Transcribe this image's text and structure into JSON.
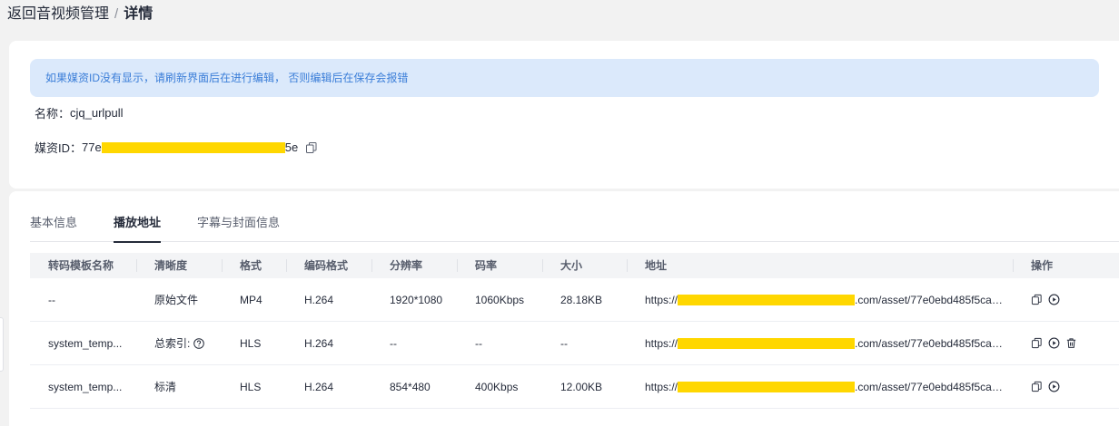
{
  "breadcrumb": {
    "back": "返回音视频管理",
    "separator": "/",
    "current": "详情"
  },
  "notice": "如果媒资ID没有显示，请刷新界面后在进行编辑， 否则编辑后在保存会报错",
  "media": {
    "name_label": "名称：",
    "name_value": "cjq_urlpull",
    "id_label": "媒资ID：",
    "id_prefix": "77e",
    "id_suffix": "5e"
  },
  "tabs": [
    {
      "label": "基本信息",
      "active": false
    },
    {
      "label": "播放地址",
      "active": true
    },
    {
      "label": "字幕与封面信息",
      "active": false
    }
  ],
  "table": {
    "headers": [
      "转码模板名称",
      "清晰度",
      "格式",
      "编码格式",
      "分辨率",
      "码率",
      "大小",
      "地址",
      "操作"
    ],
    "rows": [
      {
        "template": "--",
        "definition": "原始文件",
        "format": "MP4",
        "codec": "H.264",
        "resolution": "1920*1080",
        "bitrate": "1060Kbps",
        "size": "28.18KB",
        "url_prefix": "https://",
        "url_suffix": ".com/asset/77e0ebd485f5caf...",
        "ops": [
          "copy-icon",
          "play-icon"
        ]
      },
      {
        "template": "system_temp...",
        "definition": "总索引:",
        "format": "HLS",
        "codec": "H.264",
        "resolution": "--",
        "bitrate": "--",
        "size": "--",
        "url_prefix": "https://",
        "url_suffix": ".com/asset/77e0ebd485f5caf...",
        "ops": [
          "copy-icon",
          "play-icon",
          "delete-icon"
        ]
      },
      {
        "template": "system_temp...",
        "definition": "标清",
        "format": "HLS",
        "codec": "H.264",
        "resolution": "854*480",
        "bitrate": "400Kbps",
        "size": "12.00KB",
        "url_prefix": "https://",
        "url_suffix": ".com/asset/77e0ebd485f5caf...",
        "ops": [
          "copy-icon",
          "play-icon"
        ]
      }
    ]
  },
  "colors": {
    "notice_bg": "#dbe9fb",
    "notice_text": "#3b7ed8",
    "redaction": "#ffd700",
    "text": "#252b3a"
  }
}
